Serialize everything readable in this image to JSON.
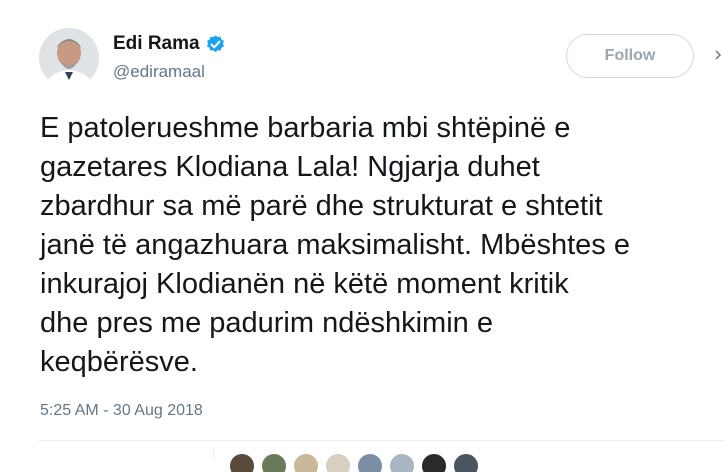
{
  "author": {
    "display_name": "Edi Rama",
    "handle": "@ediramaal",
    "verified": true,
    "avatar_icon": "user-avatar-photo"
  },
  "follow_button": {
    "label": "Follow"
  },
  "tweet": {
    "lines": [
      "E patolerueshme barbaria mbi shtëpinë e",
      "gazetares Klodiana Lala! Ngjarja duhet",
      "zbardhur sa më parë dhe strukturat e shtetit",
      "janë të angazhuara maksimalisht. Mbështes e",
      "inkurajoj Klodianën në këtë moment kritik",
      "dhe pres me padurim ndëshkimin e",
      "keqbërësve."
    ],
    "timestamp": "5:25 AM - 30 Aug 2018"
  },
  "colors": {
    "verified_badge": "#1da1f2",
    "secondary_text": "#657786",
    "primary_text": "#14171a",
    "follow_border": "#cfd9de",
    "follow_text": "#9aa5ad"
  },
  "liker_avatar_colors": [
    "#5a4a3a",
    "#6b7a5a",
    "#c9b89a",
    "#d8cfc0",
    "#7b8ea3",
    "#aab6c4",
    "#2a2a2a",
    "#4a5560"
  ]
}
